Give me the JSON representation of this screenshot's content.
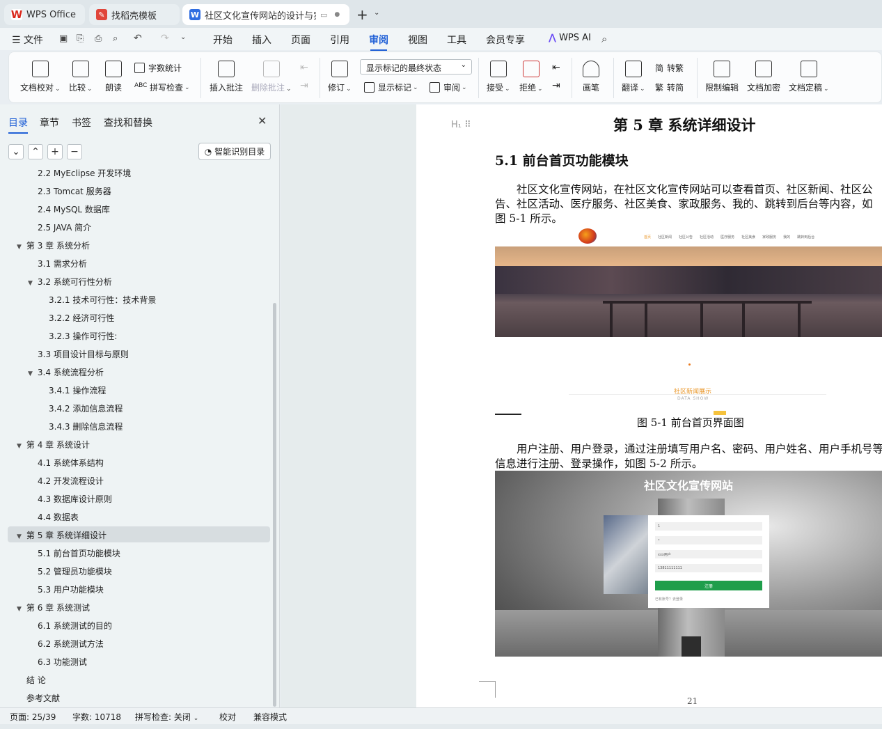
{
  "tabs": [
    {
      "label": "WPS Office",
      "icon": "wps-logo-icon",
      "color": "#d9281c"
    },
    {
      "label": "找稻壳模板",
      "icon": "docer-logo-icon",
      "color": "#e0463b"
    },
    {
      "label": "社区文化宣传网站的设计与实",
      "icon": "word-doc-icon",
      "color": "#2f6de1"
    }
  ],
  "menu": {
    "file": "文件",
    "items": [
      "开始",
      "插入",
      "页面",
      "引用",
      "审阅",
      "视图",
      "工具",
      "会员专享"
    ],
    "active": "审阅",
    "ai": "WPS AI"
  },
  "ribbon": {
    "doc_check": "文档校对",
    "compare": "比较",
    "read_aloud": "朗读",
    "word_count": "字数统计",
    "spell_check": "拼写检查",
    "insert_comment": "插入批注",
    "delete_comment": "删除批注",
    "track_changes": "修订",
    "markup_state": "显示标记的最终状态",
    "show_markup": "显示标记",
    "review_pane": "审阅",
    "accept": "接受",
    "reject": "拒绝",
    "pen": "画笔",
    "translate": "翻译",
    "to_traditional": "转繁",
    "to_simplified": "转简",
    "restrict_edit": "限制编辑",
    "encrypt": "文档加密",
    "finalize": "文档定稿"
  },
  "pane": {
    "tabs": [
      "目录",
      "章节",
      "书签",
      "查找和替换"
    ],
    "smart_btn": "智能识别目录",
    "toc": [
      {
        "label": "2.2 MyEclipse 开发环境",
        "level": 2,
        "caret": false
      },
      {
        "label": "2.3 Tomcat 服务器",
        "level": 2,
        "caret": false
      },
      {
        "label": "2.4 MySQL 数据库",
        "level": 2,
        "caret": false
      },
      {
        "label": "2.5 JAVA 简介",
        "level": 2,
        "caret": false
      },
      {
        "label": "第 3 章  系统分析",
        "level": 1,
        "caret": true
      },
      {
        "label": "3.1  需求分析",
        "level": 2,
        "caret": false
      },
      {
        "label": "3.2  系统可行性分析",
        "level": 2,
        "caret": true
      },
      {
        "label": "3.2.1 技术可行性：技术背景",
        "level": 3,
        "caret": false
      },
      {
        "label": "3.2.2 经济可行性",
        "level": 3,
        "caret": false
      },
      {
        "label": "3.2.3 操作可行性:",
        "level": 3,
        "caret": false
      },
      {
        "label": "3.3  项目设计目标与原则",
        "level": 2,
        "caret": false
      },
      {
        "label": "3.4 系统流程分析",
        "level": 2,
        "caret": true
      },
      {
        "label": "3.4.1 操作流程",
        "level": 3,
        "caret": false
      },
      {
        "label": "3.4.2 添加信息流程",
        "level": 3,
        "caret": false
      },
      {
        "label": "3.4.3 删除信息流程",
        "level": 3,
        "caret": false
      },
      {
        "label": "第 4 章  系统设计",
        "level": 1,
        "caret": true
      },
      {
        "label": "4.1  系统体系结构",
        "level": 2,
        "caret": false
      },
      {
        "label": "4.2 开发流程设计",
        "level": 2,
        "caret": false
      },
      {
        "label": "4.3  数据库设计原则",
        "level": 2,
        "caret": false
      },
      {
        "label": "4.4  数据表",
        "level": 2,
        "caret": false
      },
      {
        "label": "第 5 章  系统详细设计",
        "level": 1,
        "caret": true
      },
      {
        "label": "5.1 前台首页功能模块",
        "level": 2,
        "caret": false
      },
      {
        "label": "5.2 管理员功能模块",
        "level": 2,
        "caret": false
      },
      {
        "label": "5.3 用户功能模块",
        "level": 2,
        "caret": false
      },
      {
        "label": "第 6 章    系统测试",
        "level": 1,
        "caret": true
      },
      {
        "label": "6.1 系统测试的目的",
        "level": 2,
        "caret": false
      },
      {
        "label": "6.2 系统测试方法",
        "level": 2,
        "caret": false
      },
      {
        "label": "6.3 功能测试",
        "level": 2,
        "caret": false
      },
      {
        "label": "结    论",
        "level": 1,
        "caret": false
      },
      {
        "label": "参考文献",
        "level": 1,
        "caret": false
      }
    ]
  },
  "doc": {
    "chapter_title": "第 5 章  系统详细设计",
    "section_title": "5.1 前台首页功能模块",
    "para1": [
      "社区文化宣传网站，在社区文化宣传网站可以查看首页、社区新闻、社区公",
      "告、社区活动、医疗服务、社区美食、家政服务、我的、跳转到后台等内容，如",
      "图 5-1 所示。"
    ],
    "fig1_nav": [
      "首页",
      "社区新闻",
      "社区公告",
      "社区活动",
      "医疗服务",
      "社区美食",
      "家政服务",
      "我的",
      "跳转到后台"
    ],
    "fig1_section": "社区新闻展示",
    "fig1_section_en": "DATA SHOW",
    "fig1_caption": "图 5-1 前台首页界面图",
    "para2": [
      "用户注册、用户登录，通过注册填写用户名、密码、用户姓名、用户手机号等",
      "信息进行注册、登录操作，如图 5-2 所示。"
    ],
    "fig2_title": "社区文化宣传网站",
    "fig2_fields": [
      "1",
      "•",
      "xxx用户",
      "13811111111"
    ],
    "fig2_btn": "注册",
    "fig2_link": "已有账号？去登录",
    "page_number": "21"
  },
  "status": {
    "page": "页面: 25/39",
    "words": "字数: 10718",
    "spell": "拼写检查: 关闭",
    "proof": "校对",
    "compat": "兼容模式"
  }
}
